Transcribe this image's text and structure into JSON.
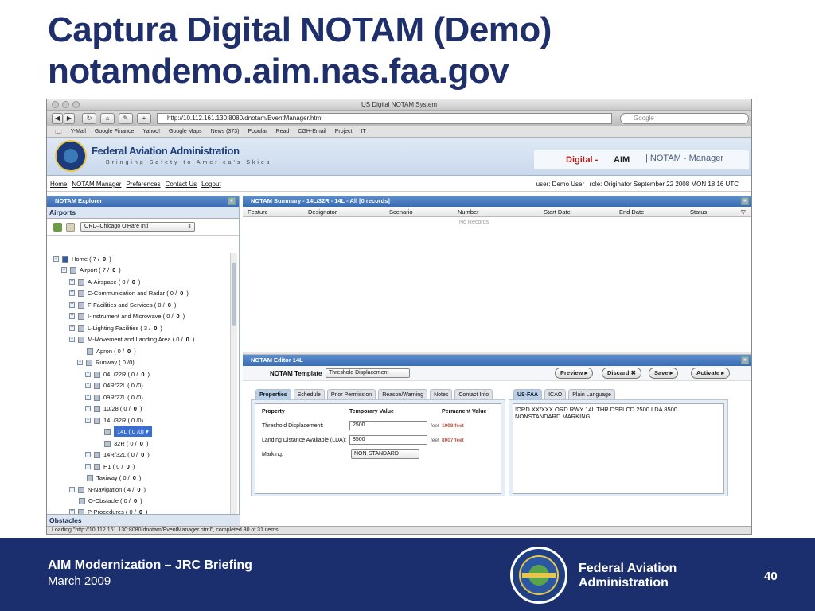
{
  "slide": {
    "title_line1": "Captura Digital NOTAM (Demo)",
    "title_line2": "notamdemo.aim.nas.faa.gov",
    "footer_title": "AIM Modernization – JRC Briefing",
    "footer_date": "March 2009",
    "footer_org_line1": "Federal Aviation",
    "footer_org_line2": "Administration",
    "page_number": "40"
  },
  "browser": {
    "window_title": "US Digital NOTAM System",
    "url": "http://10.112.161.130:8080/dnotam/EventManager.html",
    "search_placeholder": "Google",
    "bookmarks": [
      "Y-Mail",
      "Google Finance",
      "Yahoo!",
      "Google Maps",
      "News (373)",
      "Popular",
      "Read",
      "CGH-Email",
      "Project",
      "IT"
    ],
    "status": "Loading \"http://10.112.161.130:8080/dnotam/EventManager.html\", completed 30 of 31 items"
  },
  "header": {
    "org_name": "Federal Aviation Administration",
    "tagline": "Bringing Safety to America's Skies",
    "brand_digital": "Digital -",
    "brand_aim": "AIM",
    "brand_manager": "| NOTAM - Manager"
  },
  "nav": {
    "links": [
      "Home",
      "NOTAM Manager",
      "Preferences",
      "Contact Us",
      "Logout"
    ],
    "user_line": "user: Demo User I role: Originator    September 22 2008 MON 18:16 UTC"
  },
  "explorer": {
    "title": "NOTAM Explorer",
    "section": "Airports",
    "airport": "ORD–Chicago O'Hare Intl",
    "tree": [
      {
        "text": "Home ( 7 / ",
        "bold": "0",
        "tail": " )"
      },
      {
        "text": "Airport ( 7 / ",
        "bold": "0",
        "tail": " )"
      },
      {
        "text": "A-Airspace ( 0 / ",
        "bold": "0",
        "tail": " )"
      },
      {
        "text": "C-Communication and Radar ( 0 / ",
        "bold": "0",
        "tail": " )"
      },
      {
        "text": "F-Facilities and Services ( 0 / ",
        "bold": "0",
        "tail": " )"
      },
      {
        "text": "I-Instrument and Microwave ( 0 / ",
        "bold": "0",
        "tail": " )"
      },
      {
        "text": "L-Lighting Facilities ( 3 / ",
        "bold": "0",
        "tail": " )"
      },
      {
        "text": "M-Movement and Landing Area ( 0 / ",
        "bold": "0",
        "tail": " )"
      },
      {
        "text": "Apron ( 0 / ",
        "bold": "0",
        "tail": " )"
      },
      {
        "text": "Runway ( 0 /0)",
        "bold": "",
        "tail": ""
      },
      {
        "text": "04L/22R ( 0 / ",
        "bold": "0",
        "tail": " )"
      },
      {
        "text": "04R/22L ( 0 /0)",
        "bold": "",
        "tail": ""
      },
      {
        "text": "09R/27L ( 0 /0)",
        "bold": "",
        "tail": ""
      },
      {
        "text": "10/28 ( 0 / ",
        "bold": "0",
        "tail": " )"
      },
      {
        "text": "14L/32R ( 0 /0)",
        "bold": "",
        "tail": ""
      },
      {
        "text": "14L ( 0 /0) ▾",
        "bold": "",
        "tail": ""
      },
      {
        "text": "32R ( 0 / ",
        "bold": "0",
        "tail": " )"
      },
      {
        "text": "14R/32L ( 0 / ",
        "bold": "0",
        "tail": " )"
      },
      {
        "text": "H1 ( 0 / ",
        "bold": "0",
        "tail": " )"
      },
      {
        "text": "Taxiway ( 0 / ",
        "bold": "0",
        "tail": " )"
      },
      {
        "text": "N-Navigation ( 4 / ",
        "bold": "0",
        "tail": " )"
      },
      {
        "text": "O-Obstacle ( 0 / ",
        "bold": "0",
        "tail": " )"
      },
      {
        "text": "P-Procedures ( 0 / ",
        "bold": "0",
        "tail": " )"
      }
    ],
    "obstacles": "Obstacles"
  },
  "summary": {
    "title": "NOTAM Summary - 14L/32R - 14L - All [0 records]",
    "columns": [
      "Feature",
      "Designator",
      "Scenario",
      "Number",
      "Start Date",
      "End Date",
      "Status"
    ],
    "empty": "No Records"
  },
  "editor": {
    "title": "NOTAM Editor 14L",
    "template_label": "NOTAM Template",
    "template_value": "Threshold Displacement",
    "buttons": [
      "Preview",
      "Discard",
      "Save",
      "Activate"
    ],
    "tabs": [
      "Properties",
      "Schedule",
      "Prior Permission",
      "Reason/Warning",
      "Notes",
      "Contact Info"
    ],
    "output_tabs": [
      "US-FAA",
      "ICAO",
      "Plain Language"
    ],
    "col_property": "Property",
    "col_temp": "Temporary Value",
    "col_perm": "Permanent Value",
    "rows": [
      {
        "label": "Threshold Displacement:",
        "value": "2500",
        "unit": "feet",
        "perm": "1998 feet"
      },
      {
        "label": "Landing Distance Available (LDA):",
        "value": "8500",
        "unit": "feet",
        "perm": "8007 feet"
      },
      {
        "label": "Marking:",
        "value": "NON-STANDARD",
        "unit": "",
        "perm": ""
      }
    ],
    "output_text": "!ORD XX/XXX ORD RWY 14L THR DSPLCD 2500 LDA 8500\nNONSTANDARD MARKING"
  },
  "colors": {
    "title_blue": "#1f2f6b",
    "band_blue": "#1b2f6e",
    "panel_header": "#3b6cb3",
    "aim_red": "#b11c1c"
  }
}
